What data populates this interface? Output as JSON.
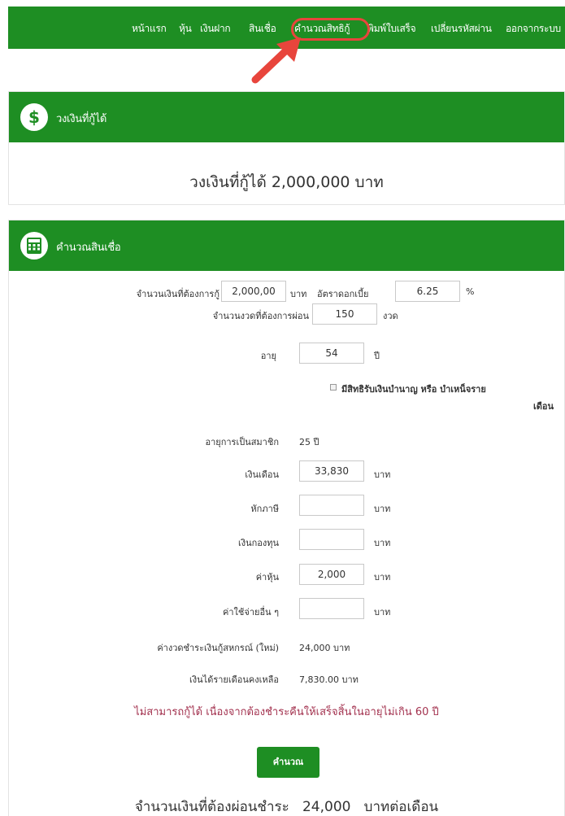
{
  "nav": {
    "items": [
      "หน้าแรก",
      "หุ้น",
      "เงินฝาก",
      "สินเชื่อ",
      "คำนวณสิทธิกู้",
      "พิมพ์ใบเสร็จ",
      "เปลี่ยนรหัสผ่าน",
      "ออกจากระบบ"
    ],
    "highlighted_item": "คำนวณสิทธิกู้"
  },
  "loan_limit": {
    "panel_title": "วงเงินที่กู้ได้",
    "summary": "วงเงินที่กู้ได้ 2,000,000 บาท"
  },
  "loan_calc": {
    "panel_title": "คำนวณสินเชื่อ",
    "amount_label": "จำนวนเงินที่ต้องการกู้",
    "amount_value": "2,000,00",
    "baht_unit": "บาท",
    "interest_label": "อัตราดอกเบี้ย",
    "interest_value": "6.25",
    "percent_unit": "%",
    "installments_label": "จำนวนงวดที่ต้องการผ่อน",
    "installments_value": "150",
    "installments_unit": "งวด",
    "age_label": "อายุ",
    "age_value": "54",
    "age_unit": "ปี",
    "pension_line1": "มีสิทธิรับเงินบำนาญ หรือ บำเหน็จราย",
    "pension_line2": "เดือน",
    "membership_label": "อายุการเป็นสมาชิก",
    "membership_value": "25 ปี",
    "salary_label": "เงินเดือน",
    "salary_value": "33,830",
    "tax_label": "หักภาษี",
    "tax_value": "",
    "fund_label": "เงินกองทุน",
    "fund_value": "",
    "share_label": "ค่าหุ้น",
    "share_value": "2,000",
    "other_label": "ค่าใช้จ่ายอื่น ๆ",
    "other_value": "",
    "coop_payment_label": "ค่างวดชำระเงินกู้สหกรณ์ (ใหม่)",
    "coop_payment_value": "24,000 บาท",
    "remaining_label": "เงินได้รายเดือนคงเหลือ",
    "remaining_value": "7,830.00 บาท",
    "error_message": "ไม่สามารถกู้ได้ เนื่องจากต้องชำระคืนให้เสร็จสิ้นในอายุไม่เกิน 60 ปี",
    "calculate_button": "คำนวณ",
    "result_label": "จำนวนเงินที่ต้องผ่อนชำระ",
    "result_value": "24,000",
    "result_unit": "บาทต่อเดือน"
  },
  "colors": {
    "primary_green": "#1e8e23",
    "highlight_red": "#e8453c",
    "error_text": "#a3324f"
  },
  "icons": [
    "dollar-icon",
    "calculator-icon",
    "pointer-arrow-icon"
  ]
}
